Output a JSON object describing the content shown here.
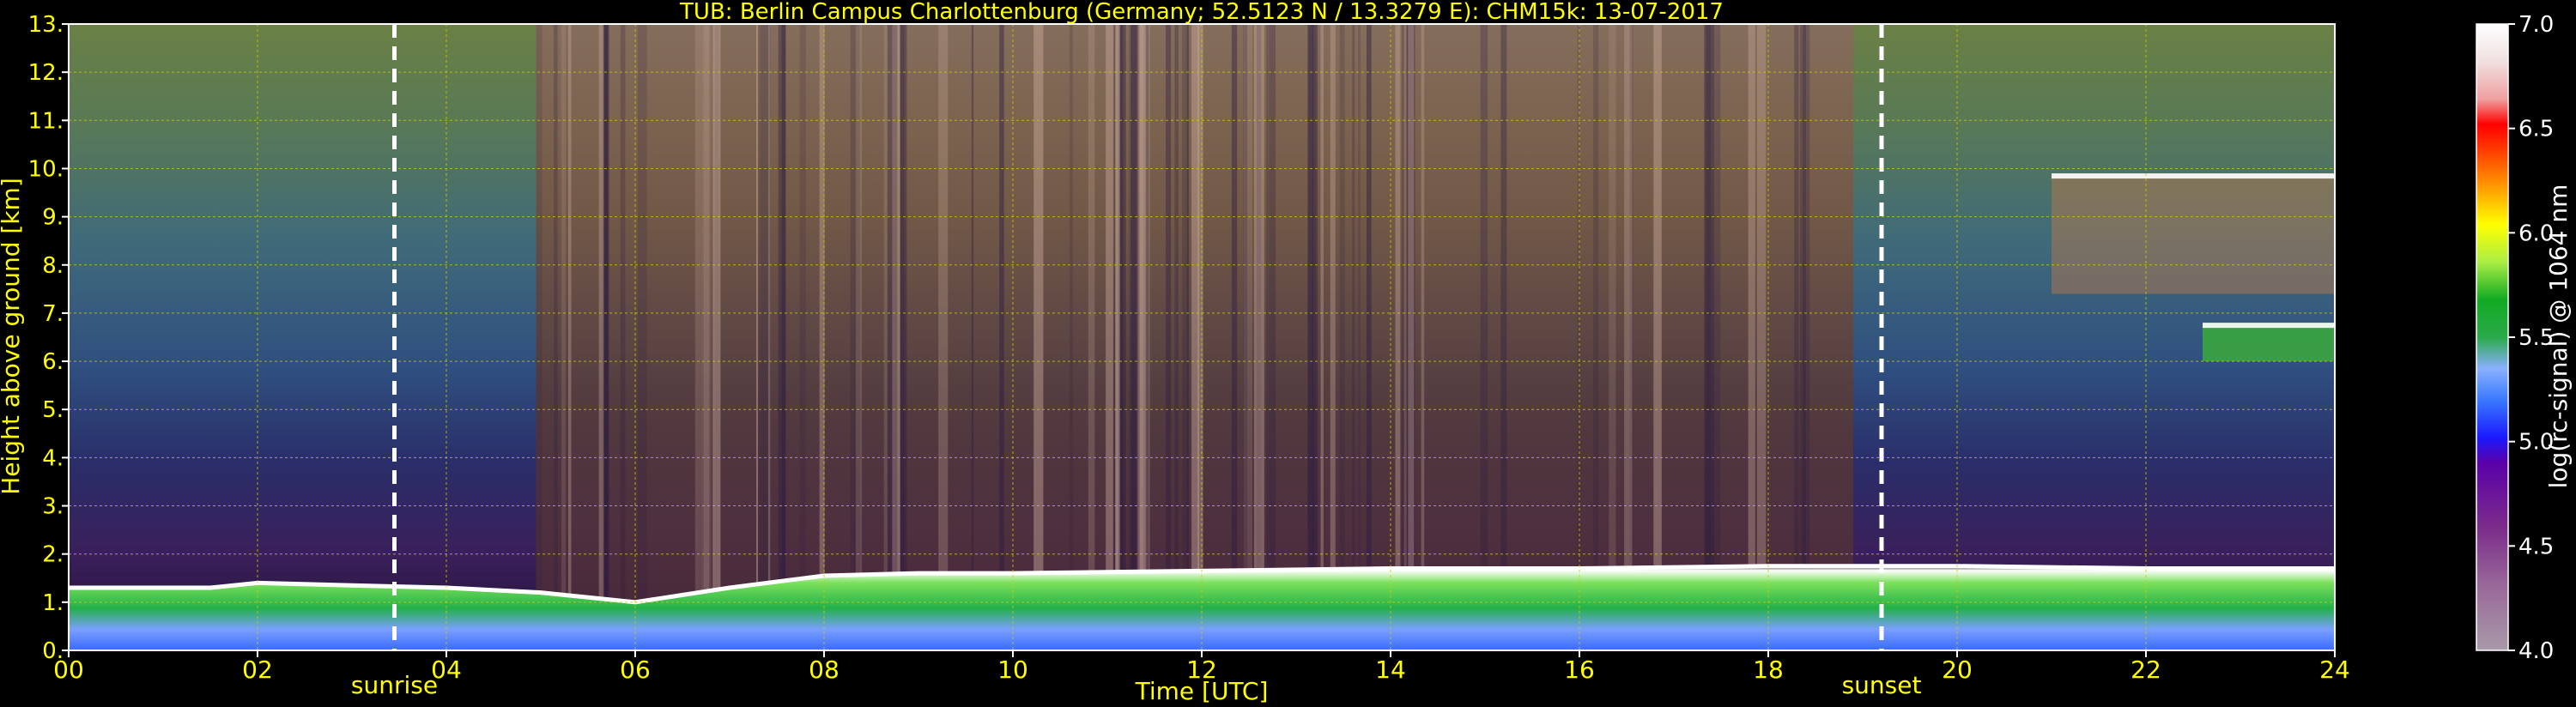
{
  "chart_data": {
    "type": "heatmap",
    "title": "TUB: Berlin Campus Charlottenburg (Germany; 52.5123 N / 13.3279 E):    CHM15k: 13-07-2017",
    "xlabel": "Time [UTC]",
    "ylabel": "Height above ground [km]",
    "x_ticks": [
      "00",
      "02",
      "04",
      "06",
      "08",
      "10",
      "12",
      "14",
      "16",
      "18",
      "20",
      "22",
      "24"
    ],
    "y_ticks": [
      "0.",
      "1.",
      "2.",
      "3.",
      "4.",
      "5.",
      "6.",
      "7.",
      "8.",
      "9.",
      "10.",
      "11.",
      "12.",
      "13."
    ],
    "xlim": [
      0,
      24
    ],
    "ylim": [
      0,
      13
    ],
    "grid": true,
    "colorbar": {
      "label": "log(rc-signal) @ 1064 nm",
      "range": [
        4.0,
        7.0
      ],
      "ticks": [
        "4.0",
        "4.5",
        "5.0",
        "5.5",
        "6.0",
        "6.5",
        "7.0"
      ]
    },
    "annotations": [
      {
        "label": "sunrise",
        "time": 3.45
      },
      {
        "label": "sunset",
        "time": 19.2
      }
    ],
    "boundary_layer_top_km": [
      [
        0,
        1.3
      ],
      [
        1.5,
        1.3
      ],
      [
        2,
        1.4
      ],
      [
        3,
        1.35
      ],
      [
        4,
        1.3
      ],
      [
        5,
        1.2
      ],
      [
        6,
        1.0
      ],
      [
        7,
        1.3
      ],
      [
        8,
        1.55
      ],
      [
        9,
        1.6
      ],
      [
        10,
        1.6
      ],
      [
        12,
        1.65
      ],
      [
        14,
        1.7
      ],
      [
        16,
        1.7
      ],
      [
        18,
        1.75
      ],
      [
        20,
        1.75
      ],
      [
        22,
        1.7
      ],
      [
        24,
        1.7
      ]
    ],
    "cloud_layers": [
      {
        "start": 22.6,
        "end": 24,
        "bottom_km": 6.0,
        "top_km": 6.8
      },
      {
        "start": 21.0,
        "end": 24,
        "bottom_km": 7.4,
        "top_km": 9.9
      }
    ],
    "colors": {
      "text": "#ffff00",
      "axis": "#ffffff",
      "grid": "#cccc00",
      "marker_line": "#ffffff",
      "colorbar_label": "#ffffff"
    }
  }
}
